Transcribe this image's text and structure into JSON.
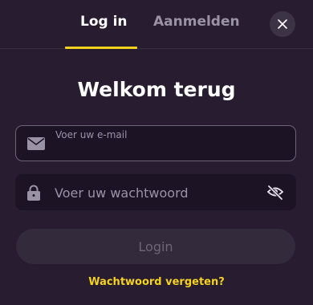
{
  "tabs": {
    "login_label": "Log in",
    "register_label": "Aanmelden"
  },
  "close_icon": "close-icon",
  "title": "Welkom terug",
  "email": {
    "label": "Voer uw e-mail",
    "value": "",
    "icon": "envelope-icon"
  },
  "password": {
    "placeholder": "Voer uw wachtwoord",
    "value": "",
    "icon": "lock-icon",
    "toggle_icon": "eye-off-icon"
  },
  "login_button": {
    "label": "Login",
    "state": "disabled"
  },
  "forgot_password": "Wachtwoord vergeten?",
  "colors": {
    "background": "#271c30",
    "accent": "#f5d21e",
    "field_background": "#1c1325",
    "muted_text": "#9a93a6"
  }
}
